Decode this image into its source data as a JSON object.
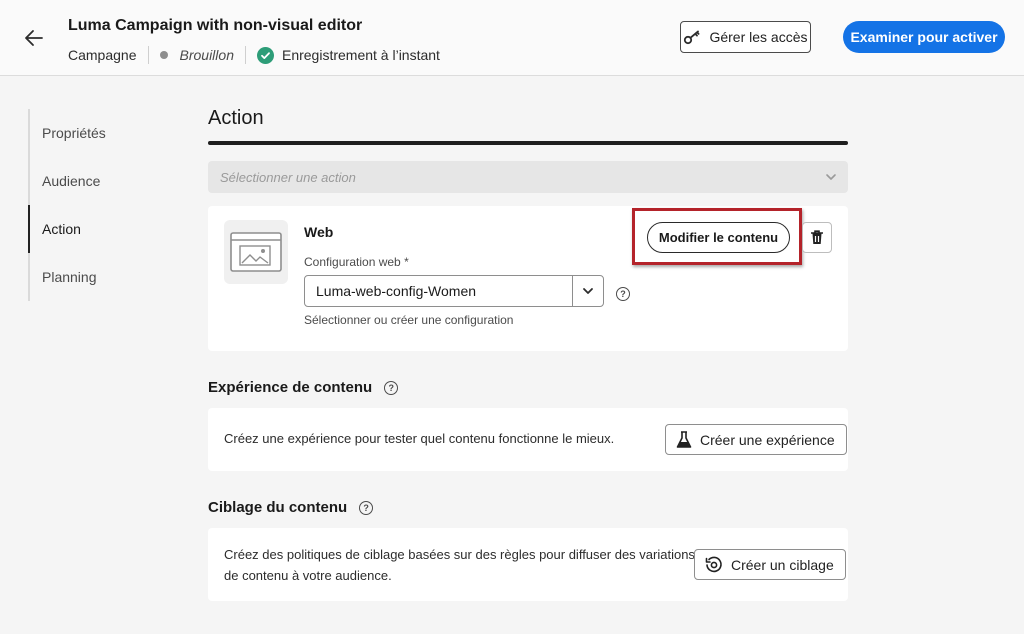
{
  "header": {
    "title": "Luma Campaign with non-visual editor",
    "type_label": "Campagne",
    "status": "Brouillon",
    "save_status": "Enregistrement à l’instant",
    "manage_access_label": "Gérer les accès",
    "review_activate_label": "Examiner pour activer",
    "icons": {
      "back": "arrow-left-icon",
      "key": "key-icon",
      "check": "checkmark-circle-icon"
    },
    "colors": {
      "primary": "#1473e6",
      "success": "#2d9d78"
    }
  },
  "sidebar": {
    "items": [
      {
        "label": "Propriétés"
      },
      {
        "label": "Audience"
      },
      {
        "label": "Action",
        "active": true
      },
      {
        "label": "Planning"
      }
    ]
  },
  "main": {
    "section_title": "Action",
    "select_action_placeholder": "Sélectionner une action",
    "web_card": {
      "channel_label": "Web",
      "modify_label": "Modifier le contenu",
      "config_label": "Configuration web",
      "config_required_marker": "*",
      "config_value": "Luma-web-config-Women",
      "config_hint": "Sélectionner ou créer une configuration",
      "highlight_color": "#b4232a",
      "icons": {
        "thumb": "web-page-icon",
        "delete": "trash-icon",
        "dropdown": "chevron-down-icon",
        "help": "help-icon"
      }
    },
    "experience": {
      "title": "Expérience de contenu",
      "description": "Créez une expérience pour tester quel contenu fonctionne le mieux.",
      "button_label": "Créer une expérience",
      "icons": {
        "button": "flask-icon",
        "help": "help-icon"
      }
    },
    "targeting": {
      "title": "Ciblage du contenu",
      "description_line1": "Créez des politiques de ciblage basées sur des règles pour diffuser des variations",
      "description_line2": "de contenu à votre audience.",
      "button_label": "Créer un ciblage",
      "icons": {
        "button": "targeting-icon",
        "help": "help-icon"
      }
    }
  }
}
